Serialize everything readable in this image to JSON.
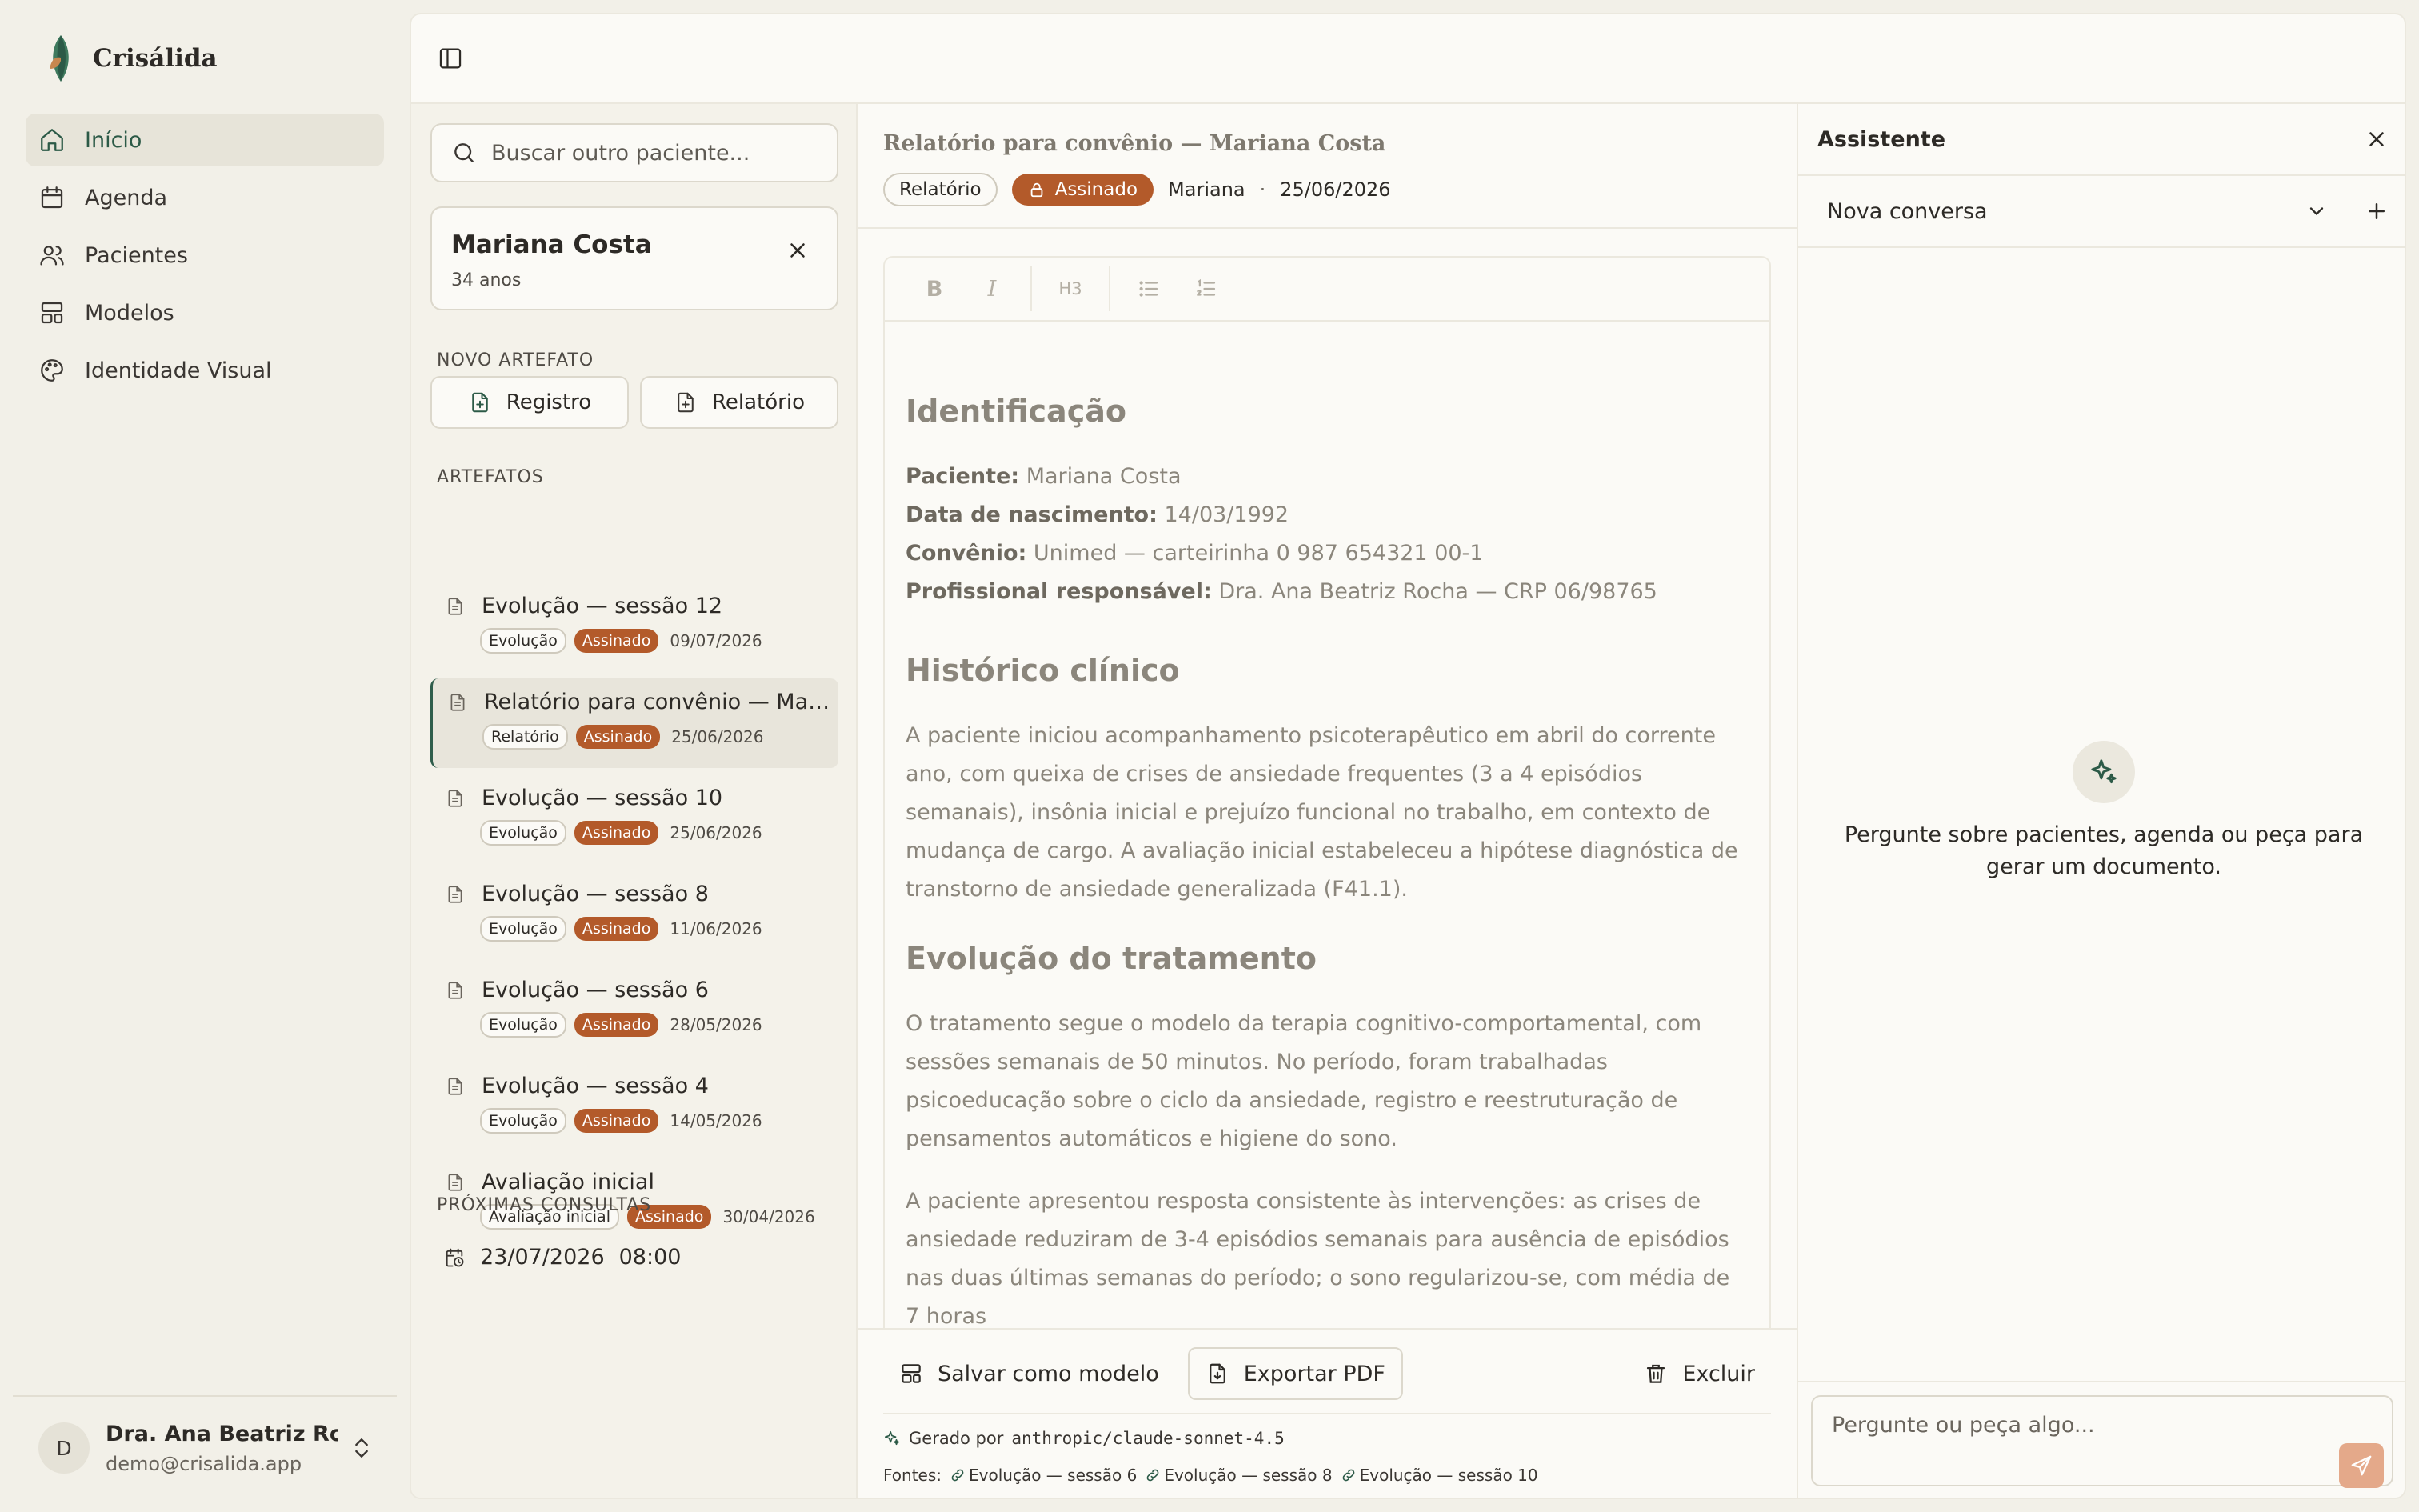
{
  "app": {
    "name": "Crisálida"
  },
  "nav": {
    "items": [
      {
        "label": "Início",
        "icon": "home-icon",
        "active": true
      },
      {
        "label": "Agenda",
        "icon": "calendar-icon",
        "active": false
      },
      {
        "label": "Pacientes",
        "icon": "users-icon",
        "active": false
      },
      {
        "label": "Modelos",
        "icon": "layout-template-icon",
        "active": false
      },
      {
        "label": "Identidade Visual",
        "icon": "palette-icon",
        "active": false
      }
    ]
  },
  "user": {
    "initial": "D",
    "name": "Dra. Ana Beatriz Roc...",
    "email": "demo@crisalida.app"
  },
  "search": {
    "placeholder": "Buscar outro paciente..."
  },
  "patient": {
    "name": "Mariana Costa",
    "age": "34 anos"
  },
  "new_artifact": {
    "label": "NOVO ARTEFATO",
    "buttons": [
      "Registro",
      "Relatório"
    ]
  },
  "artifacts": {
    "label": "ARTEFATOS",
    "items": [
      {
        "title": "Evolução — sessão 12",
        "type": "Evolução",
        "status": "Assinado",
        "date": "09/07/2026",
        "selected": false
      },
      {
        "title": "Relatório para convênio — Mari...",
        "type": "Relatório",
        "status": "Assinado",
        "date": "25/06/2026",
        "selected": true
      },
      {
        "title": "Evolução — sessão 10",
        "type": "Evolução",
        "status": "Assinado",
        "date": "25/06/2026",
        "selected": false
      },
      {
        "title": "Evolução — sessão 8",
        "type": "Evolução",
        "status": "Assinado",
        "date": "11/06/2026",
        "selected": false
      },
      {
        "title": "Evolução — sessão 6",
        "type": "Evolução",
        "status": "Assinado",
        "date": "28/05/2026",
        "selected": false
      },
      {
        "title": "Evolução — sessão 4",
        "type": "Evolução",
        "status": "Assinado",
        "date": "14/05/2026",
        "selected": false
      },
      {
        "title": "Avaliação inicial",
        "type": "Avaliação inicial",
        "status": "Assinado",
        "date": "30/04/2026",
        "selected": false
      }
    ]
  },
  "upcoming": {
    "label": "PRÓXIMAS CONSULTAS",
    "date": "23/07/2026",
    "time": "08:00"
  },
  "document": {
    "title": "Relatório para convênio — Mariana Costa",
    "type": "Relatório",
    "status": "Assinado",
    "author": "Mariana",
    "separator": "·",
    "date": "25/06/2026",
    "toolbar": {
      "bold": "B",
      "italic": "I",
      "heading": "H3"
    },
    "sections": {
      "identification_heading": "Identificação",
      "fields": [
        {
          "label": "Paciente:",
          "value": "Mariana Costa"
        },
        {
          "label": "Data de nascimento:",
          "value": "14/03/1992"
        },
        {
          "label": "Convênio:",
          "value": "Unimed — carteirinha 0 987 654321 00-1"
        },
        {
          "label": "Profissional responsável:",
          "value": "Dra. Ana Beatriz Rocha — CRP 06/98765"
        }
      ],
      "history_heading": "Histórico clínico",
      "history_text": "A paciente iniciou acompanhamento psicoterapêutico em abril do corrente ano, com queixa de crises de ansiedade frequentes (3 a 4 episódios semanais), insônia inicial e prejuízo funcional no trabalho, em contexto de mudança de cargo. A avaliação inicial estabeleceu a hipótese diagnóstica de transtorno de ansiedade generalizada (F41.1).",
      "treatment_heading": "Evolução do tratamento",
      "treatment_text_1": "O tratamento segue o modelo da terapia cognitivo-comportamental, com sessões semanais de 50 minutos. No período, foram trabalhadas psicoeducação sobre o ciclo da ansiedade, registro e reestruturação de pensamentos automáticos e higiene do sono.",
      "treatment_text_2": "A paciente apresentou resposta consistente às intervenções: as crises de ansiedade reduziram de 3-4 episódios semanais para ausência de episódios nas duas últimas semanas do período; o sono regularizou-se, com média de 7 horas"
    },
    "actions": {
      "save_template": "Salvar como modelo",
      "export_pdf": "Exportar PDF",
      "delete": "Excluir"
    },
    "generated_by_label": "Gerado por",
    "generated_by_model": "anthropic/claude-sonnet-4.5",
    "sources_label": "Fontes:",
    "sources": [
      "Evolução — sessão 6",
      "Evolução — sessão 8",
      "Evolução — sessão 10"
    ]
  },
  "assistant": {
    "title": "Assistente",
    "conversation": "Nova conversa",
    "empty_text": "Pergunte sobre pacientes, agenda ou peça para gerar um documento.",
    "input_placeholder": "Pergunte ou peça algo..."
  },
  "colors": {
    "accent": "#2c5a47",
    "signed_badge": "#b35a2a",
    "background": "#f2f0e8",
    "panel": "#fbfaf6"
  }
}
